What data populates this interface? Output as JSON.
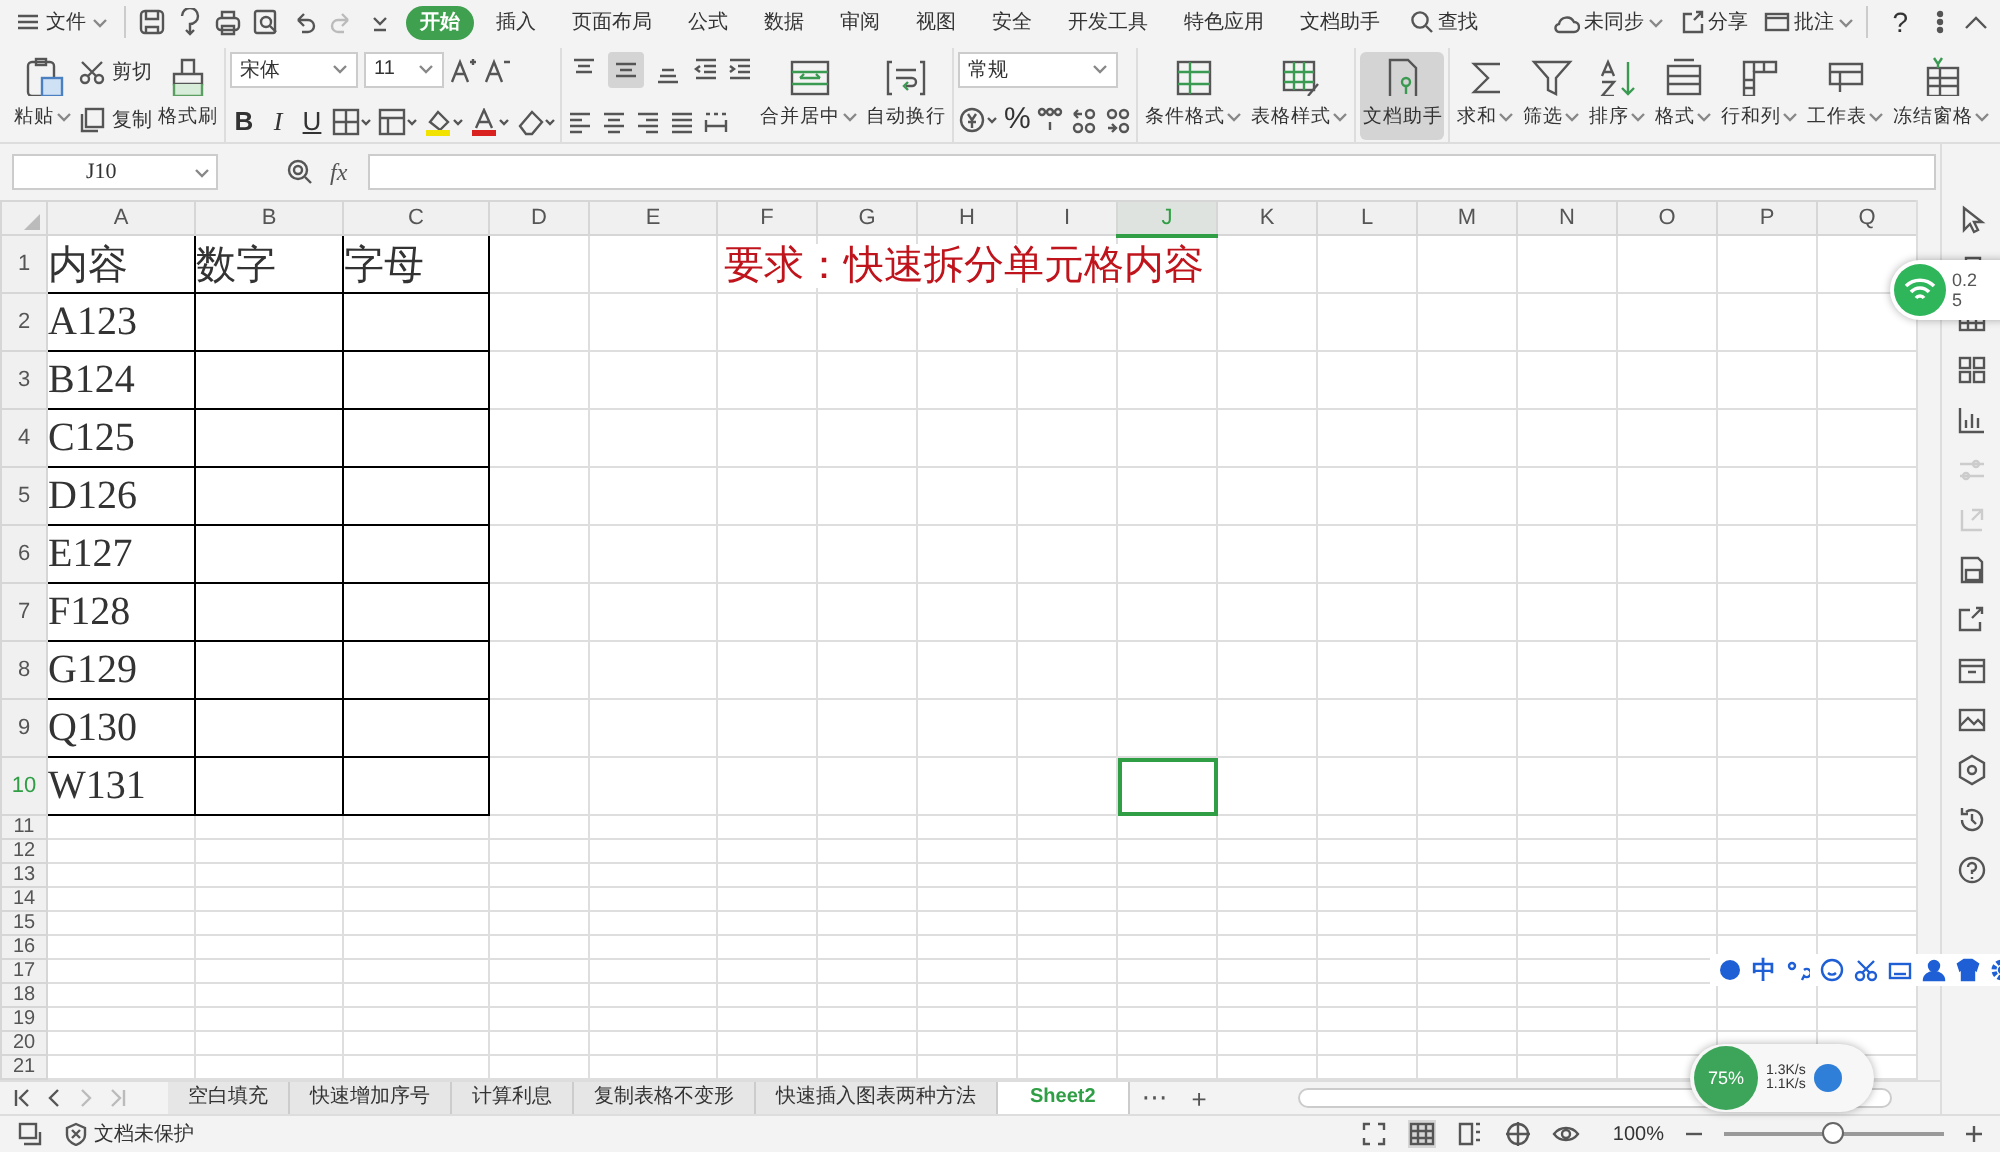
{
  "menu": {
    "file": "文件",
    "tabs": [
      {
        "label": "开始",
        "selected": true
      },
      {
        "label": "插入",
        "selected": false
      },
      {
        "label": "页面布局",
        "selected": false
      },
      {
        "label": "公式",
        "selected": false
      },
      {
        "label": "数据",
        "selected": false
      },
      {
        "label": "审阅",
        "selected": false
      },
      {
        "label": "视图",
        "selected": false
      },
      {
        "label": "安全",
        "selected": false
      },
      {
        "label": "开发工具",
        "selected": false
      },
      {
        "label": "特色应用",
        "selected": false
      },
      {
        "label": "文档助手",
        "selected": false
      }
    ],
    "search": "查找",
    "sync": "未同步",
    "share": "分享",
    "comment": "批注",
    "help": "?"
  },
  "ribbon": {
    "paste": "粘贴",
    "cut": "剪切",
    "copy": "复制",
    "format_painter": "格式刷",
    "font_name": "宋体",
    "font_size": "11",
    "bold": "B",
    "italic": "I",
    "underline": "U",
    "vertical_align": [
      {
        "selected": false
      },
      {
        "selected": true
      },
      {
        "selected": false
      }
    ],
    "merge": "合并居中",
    "wrap": "自动换行",
    "number_format": "常规",
    "percent": "%",
    "tools": [
      {
        "label": "条件格式",
        "selected": false,
        "dropdown": true
      },
      {
        "label": "表格样式",
        "selected": false,
        "dropdown": true
      },
      {
        "label": "文档助手",
        "selected": true,
        "dropdown": false
      },
      {
        "label": "求和",
        "selected": false,
        "dropdown": true
      },
      {
        "label": "筛选",
        "selected": false,
        "dropdown": true
      },
      {
        "label": "排序",
        "selected": false,
        "dropdown": true
      },
      {
        "label": "格式",
        "selected": false,
        "dropdown": true
      },
      {
        "label": "行和列",
        "selected": false,
        "dropdown": true
      },
      {
        "label": "工作表",
        "selected": false,
        "dropdown": true
      },
      {
        "label": "冻结窗格",
        "selected": false,
        "dropdown": true
      }
    ]
  },
  "formula_bar": {
    "cell_ref": "J10",
    "fx": "fx"
  },
  "sheet": {
    "columns": [
      {
        "label": "A",
        "selected": false
      },
      {
        "label": "B",
        "selected": false
      },
      {
        "label": "C",
        "selected": false
      },
      {
        "label": "D",
        "selected": false
      },
      {
        "label": "E",
        "selected": false
      },
      {
        "label": "F",
        "selected": false
      },
      {
        "label": "G",
        "selected": false
      },
      {
        "label": "H",
        "selected": false
      },
      {
        "label": "I",
        "selected": false
      },
      {
        "label": "J",
        "selected": true
      },
      {
        "label": "K",
        "selected": false
      },
      {
        "label": "L",
        "selected": false
      },
      {
        "label": "M",
        "selected": false
      },
      {
        "label": "N",
        "selected": false
      },
      {
        "label": "O",
        "selected": false
      },
      {
        "label": "P",
        "selected": false
      },
      {
        "label": "Q",
        "selected": false
      }
    ],
    "rows": [
      {
        "label": "1",
        "selected": false,
        "values": [
          "内容",
          "数字",
          "字母"
        ]
      },
      {
        "label": "2",
        "selected": false,
        "values": [
          "A123"
        ]
      },
      {
        "label": "3",
        "selected": false,
        "values": [
          "B124"
        ]
      },
      {
        "label": "4",
        "selected": false,
        "values": [
          "C125"
        ]
      },
      {
        "label": "5",
        "selected": false,
        "values": [
          "D126"
        ]
      },
      {
        "label": "6",
        "selected": false,
        "values": [
          "E127"
        ]
      },
      {
        "label": "7",
        "selected": false,
        "values": [
          "F128"
        ]
      },
      {
        "label": "8",
        "selected": false,
        "values": [
          "G129"
        ]
      },
      {
        "label": "9",
        "selected": false,
        "values": [
          "Q130"
        ]
      },
      {
        "label": "10",
        "selected": true,
        "values": [
          "W131"
        ]
      },
      {
        "label": "11",
        "selected": false
      },
      {
        "label": "12",
        "selected": false
      },
      {
        "label": "13",
        "selected": false
      },
      {
        "label": "14",
        "selected": false
      },
      {
        "label": "15",
        "selected": false
      },
      {
        "label": "16",
        "selected": false
      },
      {
        "label": "17",
        "selected": false
      },
      {
        "label": "18",
        "selected": false
      },
      {
        "label": "19",
        "selected": false
      },
      {
        "label": "20",
        "selected": false
      },
      {
        "label": "21",
        "selected": false
      }
    ],
    "note": "要求：快速拆分单元格内容"
  },
  "sheet_tabs": [
    {
      "label": "空白填充",
      "selected": false
    },
    {
      "label": "快速增加序号",
      "selected": false
    },
    {
      "label": "计算利息",
      "selected": false
    },
    {
      "label": "复制表格不变形",
      "selected": false
    },
    {
      "label": "快速插入图表两种方法",
      "selected": false
    },
    {
      "label": "Sheet2",
      "selected": true
    }
  ],
  "sheet_more": "⋯",
  "sheet_add": "+",
  "status_bar": {
    "protection": "文档未保护",
    "zoom": "100%",
    "zoom_slider": {
      "level": 0.49
    }
  },
  "wifi_widget": {
    "speed": "0.2",
    "count": "5"
  },
  "ime_toolbar": {
    "mode": "中"
  },
  "network_widget": {
    "battery": "75%",
    "upload": "1.3K/s",
    "download": "1.1K/s"
  }
}
